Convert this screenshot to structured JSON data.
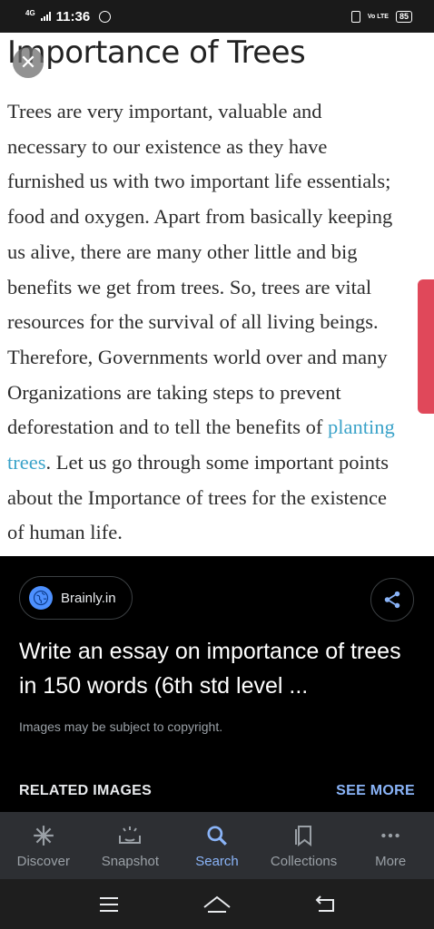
{
  "status_bar": {
    "network": "4G",
    "time": "11:36",
    "volte": "Vo LTE",
    "battery": "85"
  },
  "article": {
    "title": "Importance of Trees",
    "lines": [
      "Trees are very important, valuable and",
      "necessary to our existence as they have",
      "furnished us with two important life essentials;",
      "food and oxygen. Apart from basically keeping",
      "us alive, there are many other little and big",
      "benefits we get from trees. So, trees are vital",
      "resources for the survival of all living beings.",
      "Therefore, Governments world over and many",
      "Organizations are taking steps to prevent"
    ],
    "line10_prefix": "deforestation and to tell the benefits of ",
    "line10_link": "planting",
    "line11_link": "trees",
    "line11_suffix": ". Let us go through some important points",
    "line12": "about the Importance of trees for the existence",
    "line13": "of human life."
  },
  "panel": {
    "source": "Brainly.in",
    "title": "Write an essay on importance of trees in 150 words (6th std level ...",
    "copyright": "Images may be subject to copyright.",
    "related": "RELATED IMAGES",
    "see_more": "SEE MORE"
  },
  "bottom_nav": {
    "items": [
      {
        "label": "Discover",
        "icon": "asterisk-icon"
      },
      {
        "label": "Snapshot",
        "icon": "snapshot-icon"
      },
      {
        "label": "Search",
        "icon": "search-icon"
      },
      {
        "label": "Collections",
        "icon": "bookmark-icon"
      },
      {
        "label": "More",
        "icon": "more-dots-icon"
      }
    ],
    "active": "Search"
  },
  "colors": {
    "accent": "#8ab4f8",
    "link": "#3ba3c9",
    "nav_bg": "#2d2f33"
  }
}
